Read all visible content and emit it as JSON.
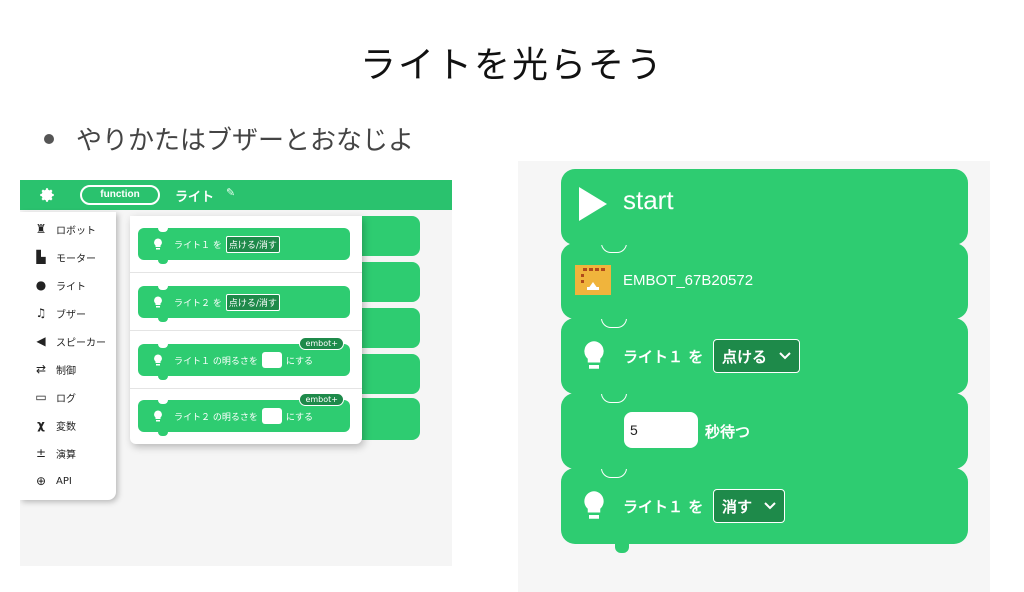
{
  "slide": {
    "title": "ライトを光らそう",
    "bullet": "やりかたはブザーとおなじよ"
  },
  "editor": {
    "function_button": "function",
    "tab_name": "ライト",
    "toolbox": [
      {
        "label": "ロボット",
        "icon": "robot-icon"
      },
      {
        "label": "モーター",
        "icon": "motor-icon"
      },
      {
        "label": "ライト",
        "icon": "lightbulb-icon"
      },
      {
        "label": "ブザー",
        "icon": "music-note-icon"
      },
      {
        "label": "スピーカー",
        "icon": "speaker-icon"
      },
      {
        "label": "制御",
        "icon": "shuffle-icon"
      },
      {
        "label": "ログ",
        "icon": "log-icon"
      },
      {
        "label": "変数",
        "icon": "variable-x-icon"
      },
      {
        "label": "演算",
        "icon": "math-icon"
      },
      {
        "label": "API",
        "icon": "globe-icon"
      }
    ],
    "flyout": [
      {
        "prefix": "ライト１ を",
        "dropdown": "点ける/消す",
        "suffix": "",
        "badge": ""
      },
      {
        "prefix": "ライト２ を",
        "dropdown": "点ける/消す",
        "suffix": "",
        "badge": ""
      },
      {
        "prefix": "ライト１ の明るさを",
        "dropdown": "",
        "suffix": "にする",
        "badge": "embot+"
      },
      {
        "prefix": "ライト２ の明るさを",
        "dropdown": "",
        "suffix": "にする",
        "badge": "embot+"
      }
    ]
  },
  "program": {
    "start_label": "start",
    "embot_name": "EMBOT_67B20572",
    "light_on": {
      "prefix": "ライト１ を",
      "value": "点ける"
    },
    "wait": {
      "value": "5",
      "suffix": "秒待つ"
    },
    "light_off": {
      "prefix": "ライト１ を",
      "value": "消す"
    }
  },
  "colors": {
    "block_green": "#2ecc71",
    "bar_green": "#2ac26e",
    "dropdown_green": "#1e8a4a",
    "embot_orange": "#f0b43c"
  }
}
